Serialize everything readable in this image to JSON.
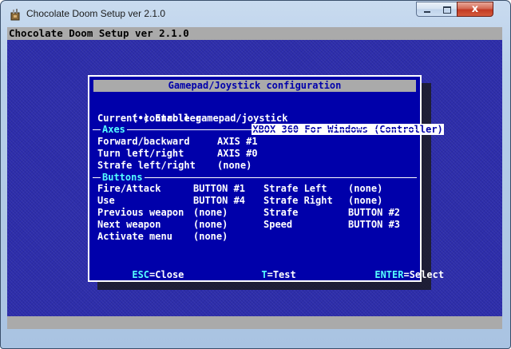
{
  "window": {
    "title": "Chocolate Doom Setup ver 2.1.0",
    "close_glyph": "x"
  },
  "app": {
    "header": "Chocolate Doom Setup ver 2.1.0"
  },
  "dialog": {
    "title": "Gamepad/Joystick configuration",
    "enable_checkbox": {
      "mark": "(•)",
      "label": "Enable gamepad/joystick"
    },
    "current_controller": {
      "label": "Current controller",
      "value": "XBOX 360 For Windows (Controller)"
    },
    "axes_label": "Axes",
    "axes": [
      {
        "label": "Forward/backward",
        "value": "AXIS #1"
      },
      {
        "label": "Turn left/right",
        "value": "AXIS #0"
      },
      {
        "label": "Strafe left/right",
        "value": "(none)"
      }
    ],
    "buttons_label": "Buttons",
    "buttons_left": [
      {
        "label": "Fire/Attack",
        "value": "BUTTON #1"
      },
      {
        "label": "Use",
        "value": "BUTTON #4"
      },
      {
        "label": "Previous weapon",
        "value": "(none)"
      },
      {
        "label": "Next weapon",
        "value": "(none)"
      },
      {
        "label": "Activate menu",
        "value": "(none)"
      }
    ],
    "buttons_right": [
      {
        "label": "Strafe Left",
        "value": "(none)"
      },
      {
        "label": "Strafe Right",
        "value": "(none)"
      },
      {
        "label": "Strafe",
        "value": "BUTTON #2"
      },
      {
        "label": "Speed",
        "value": "BUTTON #3"
      }
    ],
    "footer": {
      "esc_key": "ESC",
      "esc_action": "=Close",
      "t_key": "T",
      "t_action": "=Test",
      "enter_key": "ENTER",
      "enter_action": "=Select"
    }
  },
  "colors": {
    "dialog_bg": "#0000aa",
    "accent_cyan": "#55ffff",
    "bar_gray": "#aaaaaa"
  }
}
